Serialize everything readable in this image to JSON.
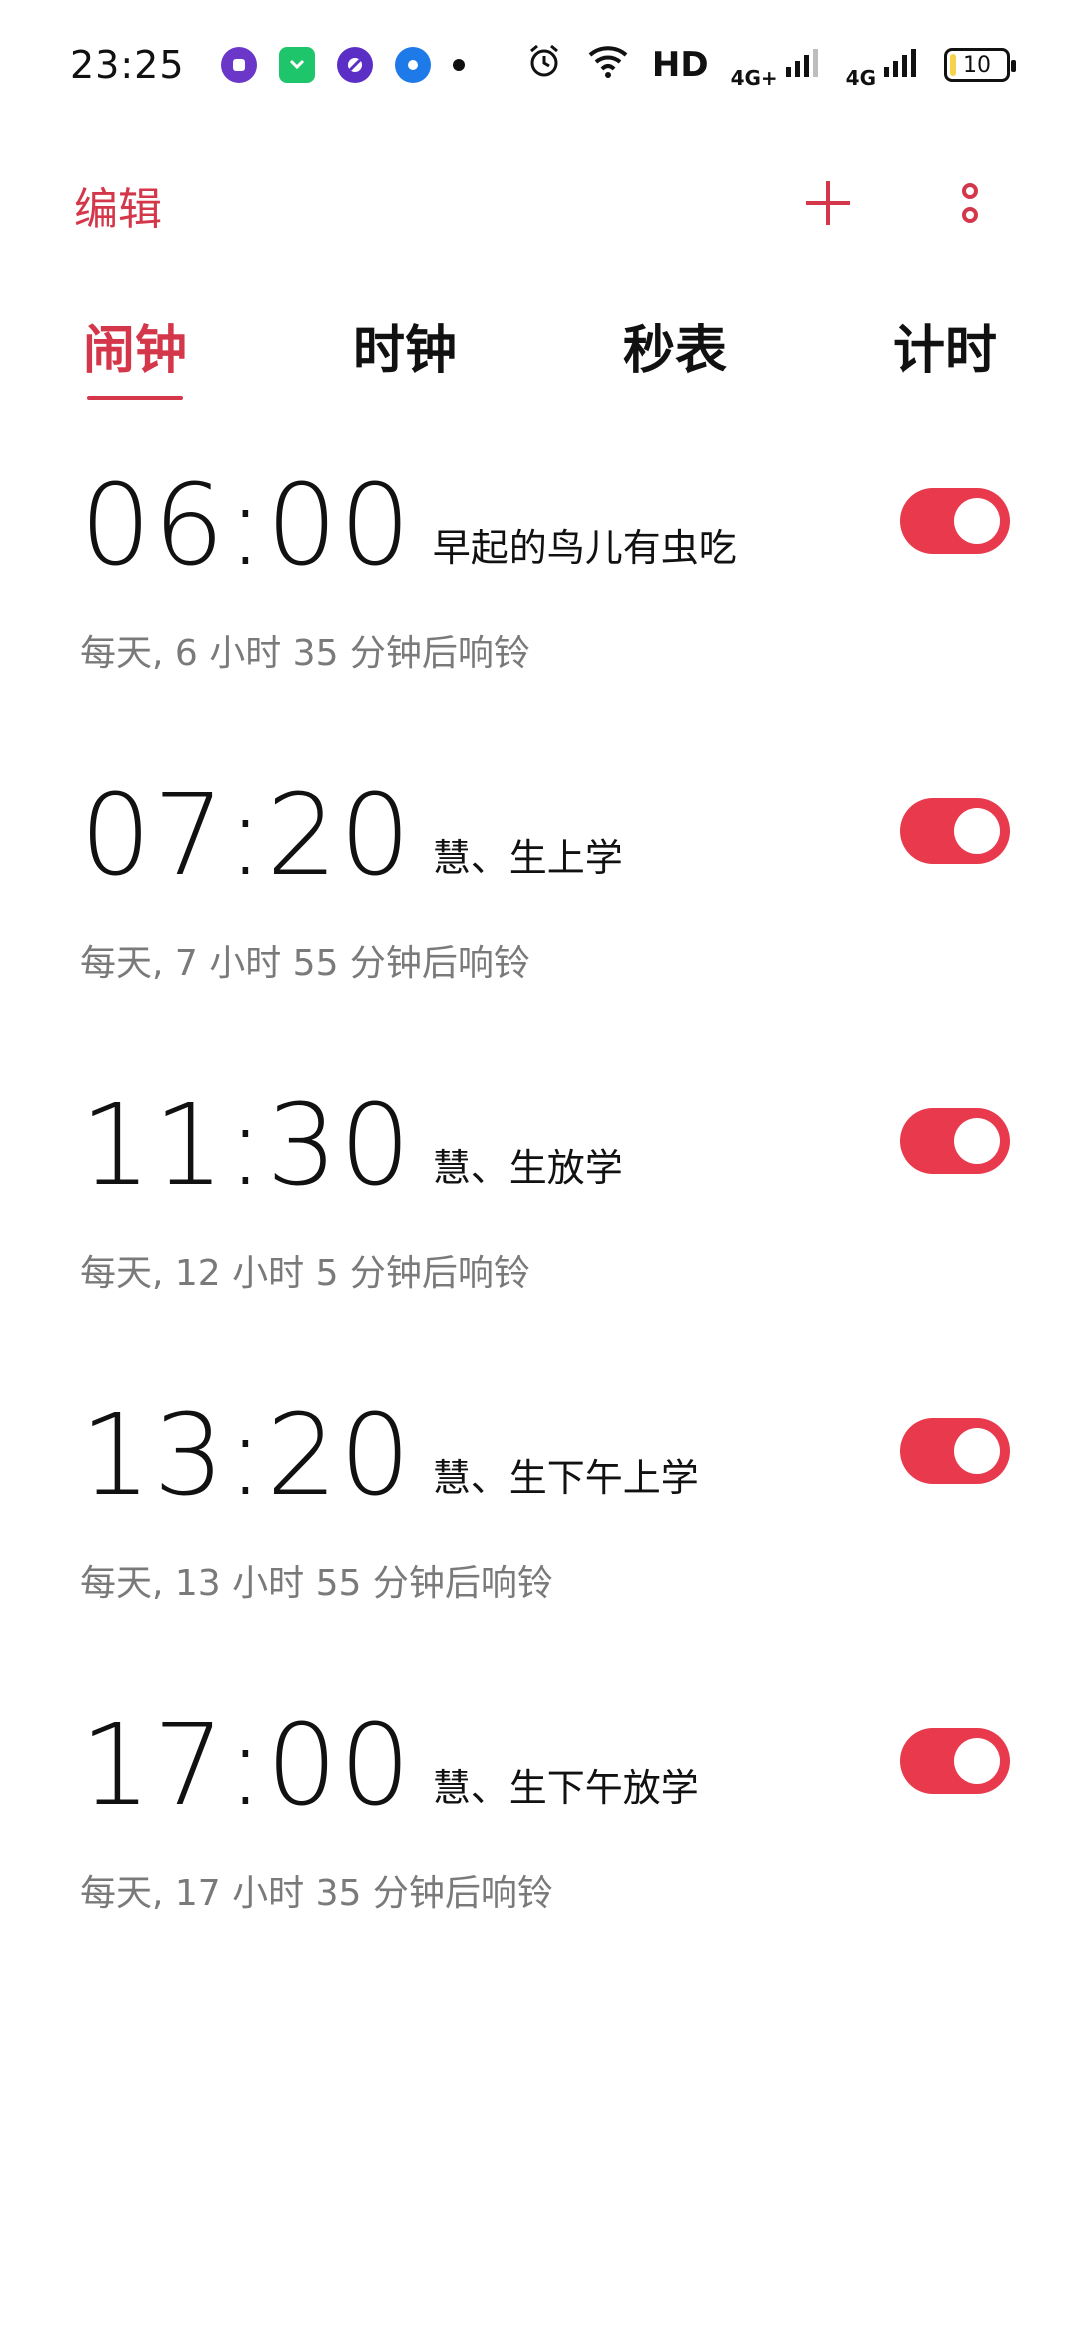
{
  "status_bar": {
    "time": "23:25",
    "network": "HD",
    "signal1": "4G+",
    "signal2": "4G",
    "battery": "10",
    "battery_level": 0.1
  },
  "top_bar": {
    "edit_label": "编辑"
  },
  "tabs": [
    {
      "label": "闹钟",
      "active": true
    },
    {
      "label": "时钟",
      "active": false
    },
    {
      "label": "秒表",
      "active": false
    },
    {
      "label": "计时",
      "active": false
    }
  ],
  "alarms": [
    {
      "time": "06:00",
      "label": "早起的鸟儿有虫吃",
      "desc": "每天, 6 小时 35 分钟后响铃",
      "enabled": true
    },
    {
      "time": "07:20",
      "label": "慧、生上学",
      "desc": "每天, 7 小时 55 分钟后响铃",
      "enabled": true
    },
    {
      "time": "11:30",
      "label": "慧、生放学",
      "desc": "每天, 12 小时 5 分钟后响铃",
      "enabled": true
    },
    {
      "time": "13:20",
      "label": "慧、生下午上学",
      "desc": "每天, 13 小时 55 分钟后响铃",
      "enabled": true
    },
    {
      "time": "17:00",
      "label": "慧、生下午放学",
      "desc": "每天, 17 小时 35 分钟后响铃",
      "enabled": true
    }
  ],
  "colors": {
    "accent": "#d4374a",
    "toggle_on": "#e83a4c",
    "text_secondary": "#7a7a7a"
  }
}
